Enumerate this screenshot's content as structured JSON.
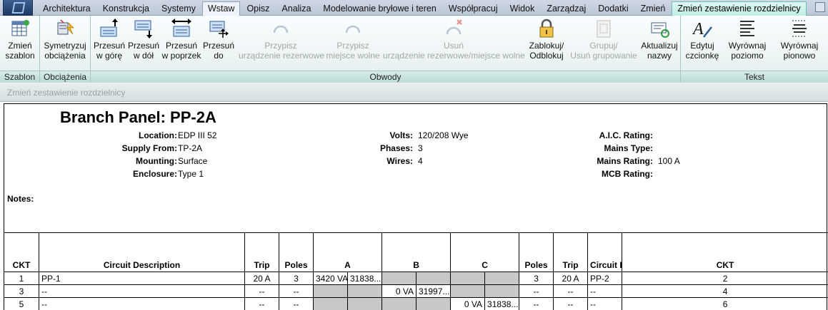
{
  "tabs": [
    "Architektura",
    "Konstrukcja",
    "Systemy",
    "Wstaw",
    "Opisz",
    "Analiza",
    "Modelowanie bryłowe i teren",
    "Współpracuj",
    "Widok",
    "Zarządzaj",
    "Dodatki",
    "Zmień",
    "Zmień zestawienie rozdzielnicy"
  ],
  "ribbon": {
    "panels": {
      "szablon": "Szablon",
      "obciazenia": "Obciążenia",
      "obwody": "Obwody",
      "tekst": "Tekst"
    },
    "buttons": {
      "zmien_szablon": [
        "Zmień",
        "szablon"
      ],
      "symetryzuj": [
        "Symetryzuj",
        "obciążenia"
      ],
      "przesun_gore": [
        "Przesuń",
        "w górę"
      ],
      "przesun_dol": [
        "Przesuń",
        "w dół"
      ],
      "przesun_poprzek": [
        "Przesuń",
        "w poprzek"
      ],
      "przesun_do": [
        "Przesuń",
        "do"
      ],
      "przypisz_rez": [
        "Przypisz",
        "urządzenie rezerwowe"
      ],
      "przypisz_miejsce": [
        "Przypisz",
        "miejsce wolne"
      ],
      "usun": [
        "Usuń",
        "urządzenie rezerwowe/miejsce wolne"
      ],
      "zablokuj": [
        "Zablokuj/",
        "Odblokuj"
      ],
      "grupuj": [
        "Grupuj/",
        "Usuń grupowanie"
      ],
      "aktualizuj": [
        "Aktualizuj",
        "nazwy"
      ],
      "edytuj": [
        "Edytuj",
        "czcionkę"
      ],
      "wyrownaj_poz": [
        "Wyrównaj",
        "poziomo"
      ],
      "wyrownaj_pion": [
        "Wyrównaj",
        "pionowo"
      ]
    }
  },
  "subbar_label": "Zmień zestawienie rozdzielnicy",
  "schedule": {
    "title": "Branch Panel: PP-2A",
    "fields": {
      "location": {
        "label": "Location:",
        "value": "EDP III 52"
      },
      "supply": {
        "label": "Supply From:",
        "value": "TP-2A"
      },
      "mounting": {
        "label": "Mounting:",
        "value": "Surface"
      },
      "enclosure": {
        "label": "Enclosure:",
        "value": "Type 1"
      },
      "volts": {
        "label": "Volts:",
        "value": "120/208 Wye"
      },
      "phases": {
        "label": "Phases:",
        "value": "3"
      },
      "wires": {
        "label": "Wires:",
        "value": "4"
      },
      "aic": {
        "label": "A.I.C. Rating:",
        "value": ""
      },
      "mains_type": {
        "label": "Mains Type:",
        "value": ""
      },
      "mains_rating": {
        "label": "Mains Rating:",
        "value": "100 A"
      },
      "mcb": {
        "label": "MCB Rating:",
        "value": ""
      }
    },
    "notes_label": "Notes:",
    "headers": [
      "CKT",
      "Circuit Description",
      "Trip",
      "Poles",
      "A",
      "B",
      "C",
      "Poles",
      "Trip",
      "Circuit Description",
      "CKT"
    ],
    "rows": [
      {
        "ckt_l": "1",
        "desc_l": "PP-1",
        "trip_l": "20 A",
        "poles_l": "3",
        "a1": "3420 VA",
        "a2": "31838...",
        "b1": "",
        "b2": "",
        "c1": "",
        "c2": "",
        "poles_r": "3",
        "trip_r": "20 A",
        "desc_r": "PP-2",
        "ckt_r": "2"
      },
      {
        "ckt_l": "3",
        "desc_l": "--",
        "trip_l": "--",
        "poles_l": "--",
        "a1": "",
        "a2": "",
        "b1": "0 VA",
        "b2": "31997...",
        "c1": "",
        "c2": "",
        "poles_r": "--",
        "trip_r": "--",
        "desc_r": "--",
        "ckt_r": "4"
      },
      {
        "ckt_l": "5",
        "desc_l": "--",
        "trip_l": "--",
        "poles_l": "--",
        "a1": "",
        "a2": "",
        "b1": "",
        "b2": "",
        "c1": "0 VA",
        "c2": "31838...",
        "poles_r": "--",
        "trip_r": "--",
        "desc_r": "--",
        "ckt_r": "6"
      }
    ]
  }
}
